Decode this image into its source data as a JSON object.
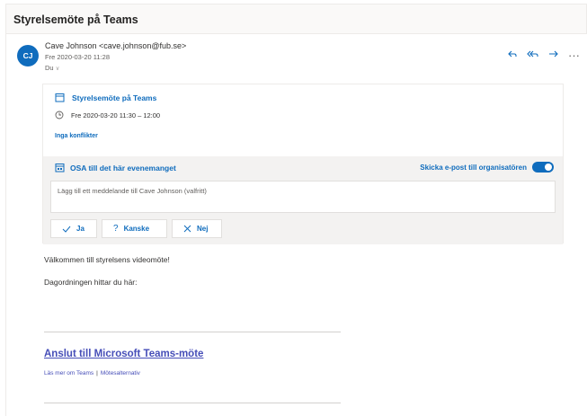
{
  "subject": "Styrelsemöte på Teams",
  "header": {
    "avatar_initials": "CJ",
    "sender": "Cave Johnson <cave.johnson@fub.se>",
    "date": "Fre 2020-03-20 11:28",
    "to_label": "Du",
    "actions": {
      "reply_icon": "reply-icon",
      "reply_all_icon": "reply-all-icon",
      "forward_icon": "forward-icon",
      "more": "···"
    }
  },
  "meeting": {
    "title": "Styrelsemöte på Teams",
    "time": "Fre 2020-03-20 11:30 – 12:00",
    "conflicts": "Inga konflikter"
  },
  "rsvp": {
    "title": "OSA till det här evenemanget",
    "notify_label": "Skicka e-post till organisatören",
    "notify_on": true,
    "message_placeholder": "Lägg till ett meddelande till Cave Johnson (valfritt)",
    "buttons": {
      "yes": "Ja",
      "maybe": "Kanske",
      "no": "Nej"
    }
  },
  "body": {
    "welcome": "Välkommen till styrelsens videomöte!",
    "agenda": "Dagordningen hittar du här:",
    "join_link": "Anslut till Microsoft Teams-möte",
    "learn_more": "Läs mer om Teams",
    "separator": "|",
    "options": "Mötesalternativ"
  },
  "colors": {
    "accent": "#0f6cbd",
    "teams": "#464eb8"
  }
}
